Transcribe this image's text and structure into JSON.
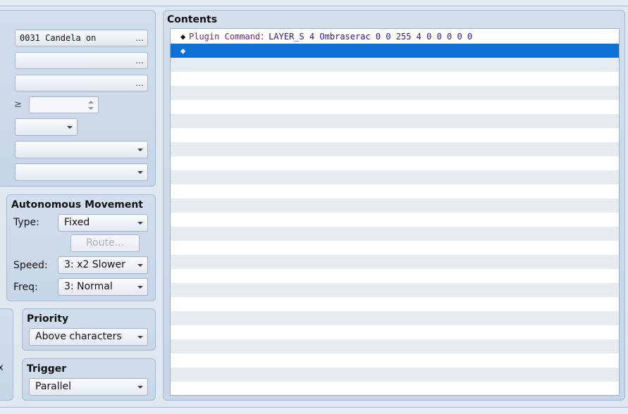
{
  "left": {
    "conditions": {
      "switch1_value": "0031 Candela on",
      "switch2_value": "",
      "variable_value": "",
      "ge_symbol": "≥",
      "variable_number": "",
      "self_switch_value": "",
      "item_value": "",
      "actor_value": "",
      "ellipsis": "…"
    },
    "autonomous": {
      "title": "Autonomous Movement",
      "type_label": "Type:",
      "type_value": "Fixed",
      "route_button": "Route...",
      "speed_label": "Speed:",
      "speed_value": "3: x2 Slower",
      "freq_label": "Freq:",
      "freq_value": "3: Normal"
    },
    "priority": {
      "title": "Priority",
      "value": "Above characters"
    },
    "trigger": {
      "title": "Trigger",
      "value": "Parallel"
    },
    "cut_char": "x"
  },
  "contents": {
    "title": "Contents",
    "rows": [
      {
        "marker": "◆",
        "name": "Plugin Command",
        "sep": "：",
        "args": "LAYER_S 4 Ombraserac 0 0 255 4 0 0 0 0 0"
      },
      {
        "marker": "◆",
        "name": "",
        "sep": "",
        "args": ""
      }
    ]
  }
}
